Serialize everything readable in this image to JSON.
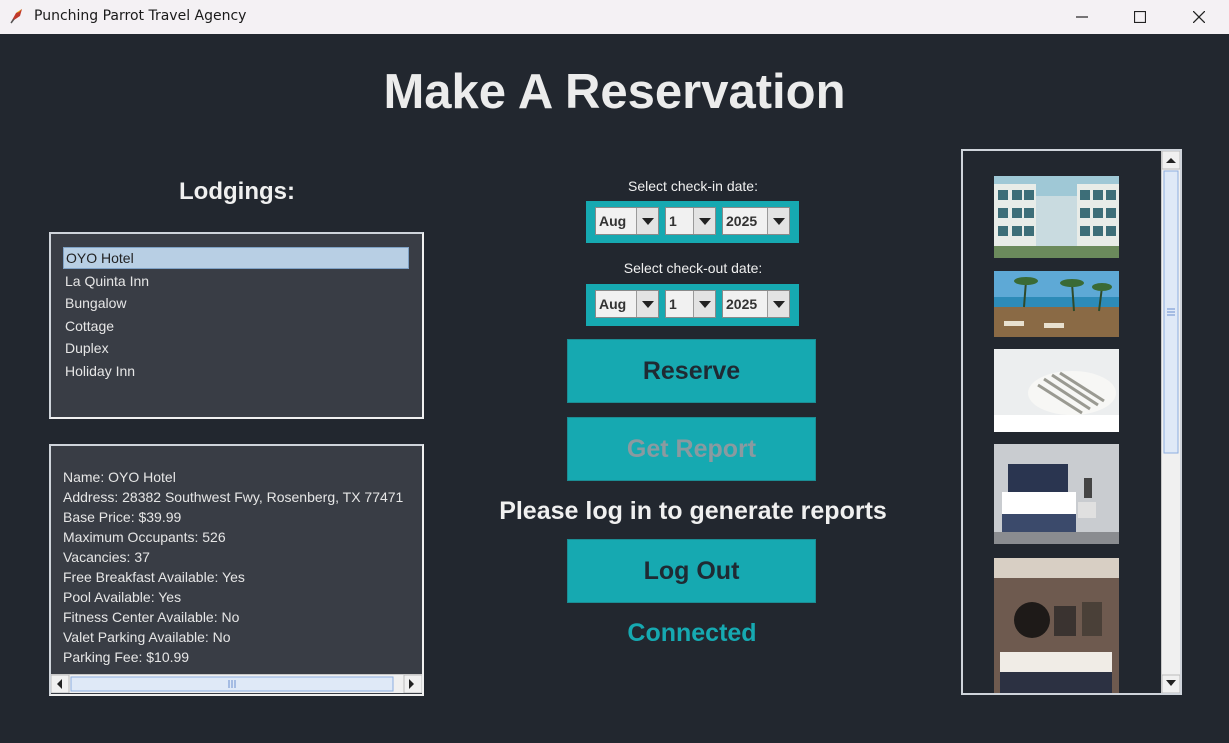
{
  "window": {
    "title": "Punching Parrot Travel Agency"
  },
  "page": {
    "heading": "Make A Reservation"
  },
  "lodgings": {
    "label": "Lodgings:",
    "items": [
      "OYO Hotel",
      "La Quinta Inn",
      "Bungalow",
      "Cottage",
      "Duplex",
      "Holiday Inn"
    ],
    "selected": "OYO Hotel"
  },
  "details": {
    "lines": [
      "Name: OYO Hotel",
      "Address: 28382 Southwest Fwy, Rosenberg, TX 77471",
      "Base Price: $39.99",
      "Maximum Occupants: 526",
      "Vacancies: 37",
      "Free Breakfast Available: Yes",
      "Pool Available: Yes",
      "Fitness Center Available: No",
      "Valet Parking Available: No",
      "Parking Fee: $10.99"
    ]
  },
  "checkin": {
    "label": "Select check-in date:",
    "month": "Aug",
    "day": "1",
    "year": "2025"
  },
  "checkout": {
    "label": "Select check-out date:",
    "month": "Aug",
    "day": "1",
    "year": "2025"
  },
  "buttons": {
    "reserve": "Reserve",
    "report": "Get Report",
    "logout": "Log Out"
  },
  "notice": "Please log in to generate reports",
  "status": "Connected",
  "colors": {
    "accent": "#16a9b1",
    "background": "#22272f",
    "panel": "#393d45"
  }
}
